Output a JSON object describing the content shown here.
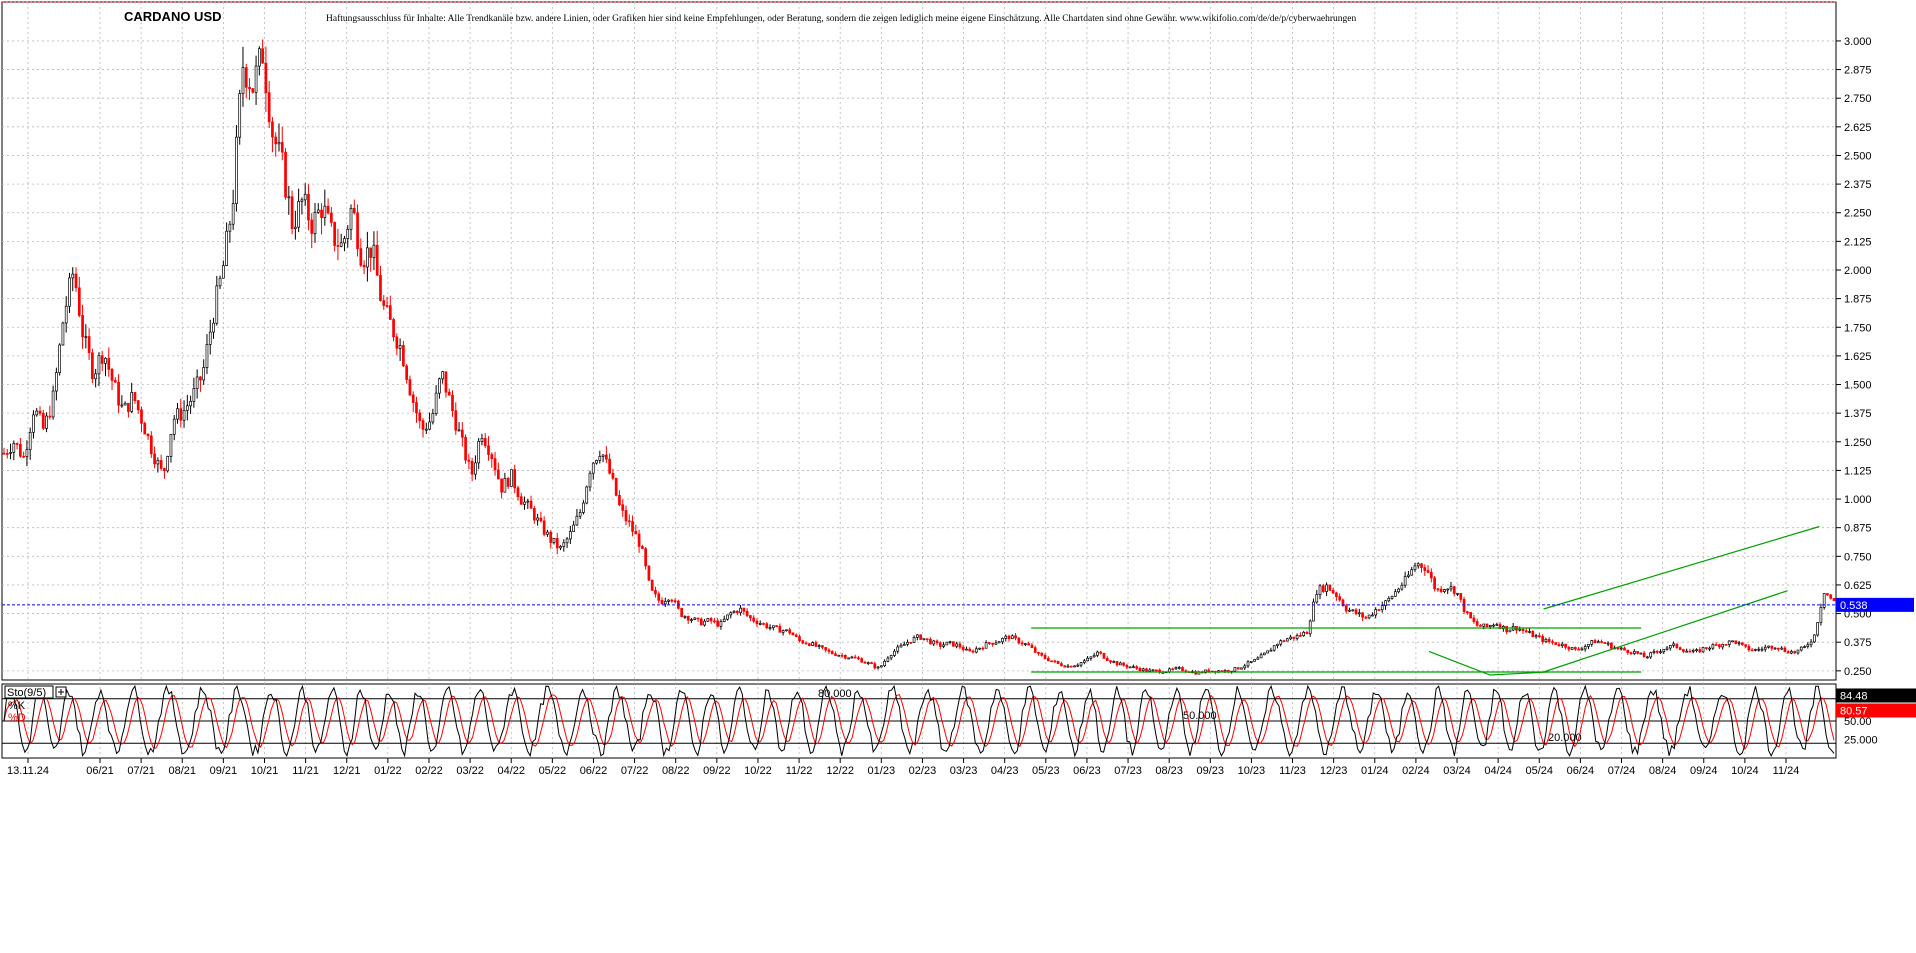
{
  "chart_data": {
    "type": "candlestick",
    "title": "CARDANO USD",
    "disclaimer": "Haftungsausschluss für Inhalte: Alle Trendkanäle bzw. andere Linien, oder Grafiken hier sind keine Empfehlungen, oder Beratung, sondern die zeigen lediglich meine eigene Einschätzung. Alle Chartdaten sind ohne Gewähr. www.wikifolio.com/de/de/p/cyberwaehrungen",
    "ylim": [
      0.21,
      3.17
    ],
    "y_ticks": [
      "3.000",
      "2.875",
      "2.750",
      "2.625",
      "2.500",
      "2.375",
      "2.250",
      "2.125",
      "2.000",
      "1.875",
      "1.750",
      "1.625",
      "1.500",
      "1.375",
      "1.250",
      "1.125",
      "1.000",
      "0.875",
      "0.750",
      "0.625",
      "0.500",
      "0.375",
      "0.250"
    ],
    "x_ticks": [
      "13.11.24",
      "06/21",
      "07/21",
      "08/21",
      "09/21",
      "10/21",
      "11/21",
      "12/21",
      "01/22",
      "02/22",
      "03/22",
      "04/22",
      "05/22",
      "06/22",
      "07/22",
      "08/22",
      "09/22",
      "10/22",
      "11/22",
      "12/22",
      "01/23",
      "02/23",
      "03/23",
      "04/23",
      "05/23",
      "06/23",
      "07/23",
      "08/23",
      "09/23",
      "10/23",
      "11/23",
      "12/23",
      "01/24",
      "02/24",
      "03/24",
      "04/24",
      "05/24",
      "06/24",
      "07/24",
      "08/24",
      "09/24",
      "10/24",
      "11/24"
    ],
    "current_price": "0.538",
    "current_price_value": 0.538,
    "grid": true,
    "price_path": [
      [
        0.0,
        1.2
      ],
      [
        0.02,
        1.25
      ],
      [
        0.04,
        1.18
      ],
      [
        0.06,
        1.4
      ],
      [
        0.08,
        1.3
      ],
      [
        0.1,
        1.45
      ],
      [
        0.12,
        1.8
      ],
      [
        0.14,
        2.0
      ],
      [
        0.16,
        1.7
      ],
      [
        0.18,
        1.55
      ],
      [
        0.2,
        1.65
      ],
      [
        0.22,
        1.5
      ],
      [
        0.24,
        1.38
      ],
      [
        0.26,
        1.45
      ],
      [
        0.28,
        1.33
      ],
      [
        0.3,
        1.2
      ],
      [
        0.32,
        1.1
      ],
      [
        0.34,
        1.35
      ],
      [
        0.36,
        1.38
      ],
      [
        0.38,
        1.45
      ],
      [
        0.4,
        1.55
      ],
      [
        0.42,
        1.8
      ],
      [
        0.44,
        2.0
      ],
      [
        0.46,
        2.3
      ],
      [
        0.48,
        2.9
      ],
      [
        0.5,
        2.8
      ],
      [
        0.52,
        2.95
      ],
      [
        0.54,
        2.6
      ],
      [
        0.56,
        2.45
      ],
      [
        0.58,
        2.2
      ],
      [
        0.6,
        2.3
      ],
      [
        0.62,
        2.2
      ],
      [
        0.64,
        2.28
      ],
      [
        0.66,
        2.15
      ],
      [
        0.68,
        2.1
      ],
      [
        0.7,
        2.28
      ],
      [
        0.72,
        2.05
      ],
      [
        0.74,
        2.1
      ],
      [
        0.76,
        1.85
      ],
      [
        0.78,
        1.75
      ],
      [
        0.8,
        1.65
      ],
      [
        0.82,
        1.45
      ],
      [
        0.84,
        1.3
      ],
      [
        0.86,
        1.35
      ],
      [
        0.88,
        1.55
      ],
      [
        0.9,
        1.4
      ],
      [
        0.92,
        1.25
      ],
      [
        0.94,
        1.1
      ],
      [
        0.96,
        1.3
      ],
      [
        0.98,
        1.2
      ],
      [
        1.0,
        1.05
      ],
      [
        1.02,
        1.1
      ],
      [
        1.04,
        1.0
      ],
      [
        1.06,
        0.95
      ],
      [
        1.08,
        0.88
      ],
      [
        1.1,
        0.82
      ],
      [
        1.12,
        0.78
      ],
      [
        1.14,
        0.85
      ],
      [
        1.16,
        0.95
      ],
      [
        1.18,
        1.15
      ],
      [
        1.2,
        1.22
      ],
      [
        1.22,
        1.1
      ],
      [
        1.24,
        0.95
      ],
      [
        1.26,
        0.88
      ],
      [
        1.28,
        0.8
      ],
      [
        1.3,
        0.6
      ],
      [
        1.32,
        0.55
      ],
      [
        1.34,
        0.58
      ],
      [
        1.36,
        0.5
      ],
      [
        1.38,
        0.48
      ],
      [
        1.4,
        0.46
      ],
      [
        1.42,
        0.47
      ],
      [
        1.44,
        0.45
      ],
      [
        1.46,
        0.5
      ],
      [
        1.48,
        0.52
      ],
      [
        1.5,
        0.48
      ],
      [
        1.52,
        0.46
      ],
      [
        1.54,
        0.44
      ],
      [
        1.56,
        0.43
      ],
      [
        1.58,
        0.42
      ],
      [
        1.6,
        0.38
      ],
      [
        1.62,
        0.37
      ],
      [
        1.64,
        0.35
      ],
      [
        1.66,
        0.33
      ],
      [
        1.68,
        0.32
      ],
      [
        1.7,
        0.31
      ],
      [
        1.72,
        0.3
      ],
      [
        1.74,
        0.28
      ],
      [
        1.76,
        0.26
      ],
      [
        1.78,
        0.32
      ],
      [
        1.8,
        0.35
      ],
      [
        1.82,
        0.38
      ],
      [
        1.84,
        0.4
      ],
      [
        1.86,
        0.38
      ],
      [
        1.88,
        0.36
      ],
      [
        1.9,
        0.37
      ],
      [
        1.92,
        0.36
      ],
      [
        1.94,
        0.33
      ],
      [
        1.96,
        0.35
      ],
      [
        1.98,
        0.37
      ],
      [
        2.0,
        0.38
      ],
      [
        2.02,
        0.4
      ],
      [
        2.04,
        0.38
      ],
      [
        2.06,
        0.36
      ],
      [
        2.08,
        0.32
      ],
      [
        2.1,
        0.3
      ],
      [
        2.12,
        0.28
      ],
      [
        2.14,
        0.27
      ],
      [
        2.16,
        0.28
      ],
      [
        2.18,
        0.3
      ],
      [
        2.2,
        0.33
      ],
      [
        2.22,
        0.3
      ],
      [
        2.24,
        0.28
      ],
      [
        2.26,
        0.27
      ],
      [
        2.28,
        0.26
      ],
      [
        2.3,
        0.25
      ],
      [
        2.32,
        0.25
      ],
      [
        2.34,
        0.25
      ],
      [
        2.36,
        0.26
      ],
      [
        2.38,
        0.25
      ],
      [
        2.4,
        0.24
      ],
      [
        2.42,
        0.25
      ],
      [
        2.44,
        0.25
      ],
      [
        2.46,
        0.25
      ],
      [
        2.48,
        0.26
      ],
      [
        2.5,
        0.28
      ],
      [
        2.52,
        0.3
      ],
      [
        2.54,
        0.33
      ],
      [
        2.56,
        0.37
      ],
      [
        2.58,
        0.39
      ],
      [
        2.6,
        0.4
      ],
      [
        2.62,
        0.42
      ],
      [
        2.64,
        0.6
      ],
      [
        2.66,
        0.62
      ],
      [
        2.68,
        0.58
      ],
      [
        2.7,
        0.52
      ],
      [
        2.72,
        0.5
      ],
      [
        2.74,
        0.48
      ],
      [
        2.76,
        0.52
      ],
      [
        2.78,
        0.55
      ],
      [
        2.8,
        0.6
      ],
      [
        2.82,
        0.65
      ],
      [
        2.84,
        0.72
      ],
      [
        2.86,
        0.7
      ],
      [
        2.88,
        0.6
      ],
      [
        2.9,
        0.62
      ],
      [
        2.92,
        0.6
      ],
      [
        2.94,
        0.5
      ],
      [
        2.96,
        0.45
      ],
      [
        2.98,
        0.44
      ],
      [
        3.0,
        0.46
      ],
      [
        3.02,
        0.43
      ],
      [
        3.04,
        0.44
      ],
      [
        3.06,
        0.42
      ],
      [
        3.08,
        0.4
      ],
      [
        3.1,
        0.38
      ],
      [
        3.12,
        0.37
      ],
      [
        3.14,
        0.36
      ],
      [
        3.16,
        0.34
      ],
      [
        3.18,
        0.36
      ],
      [
        3.2,
        0.38
      ],
      [
        3.22,
        0.37
      ],
      [
        3.24,
        0.35
      ],
      [
        3.26,
        0.34
      ],
      [
        3.28,
        0.33
      ],
      [
        3.3,
        0.31
      ],
      [
        3.32,
        0.33
      ],
      [
        3.34,
        0.35
      ],
      [
        3.36,
        0.36
      ],
      [
        3.38,
        0.34
      ],
      [
        3.4,
        0.33
      ],
      [
        3.42,
        0.35
      ],
      [
        3.44,
        0.36
      ],
      [
        3.46,
        0.37
      ],
      [
        3.48,
        0.38
      ],
      [
        3.5,
        0.35
      ],
      [
        3.52,
        0.34
      ],
      [
        3.54,
        0.35
      ],
      [
        3.56,
        0.36
      ],
      [
        3.58,
        0.34
      ],
      [
        3.6,
        0.33
      ],
      [
        3.62,
        0.35
      ],
      [
        3.64,
        0.4
      ],
      [
        3.66,
        0.6
      ],
      [
        3.68,
        0.55
      ]
    ],
    "trendlines": [
      {
        "points": [
          [
            0.842,
            0.437
          ],
          [
            1.342,
            0.437
          ]
        ]
      },
      {
        "points": [
          [
            0.842,
            0.245
          ],
          [
            1.342,
            0.245
          ]
        ]
      },
      {
        "points": [
          [
            1.168,
            0.335
          ],
          [
            1.218,
            0.232
          ],
          [
            1.265,
            0.245
          ]
        ]
      },
      {
        "points": [
          [
            1.262,
            0.245
          ],
          [
            1.462,
            0.6
          ]
        ]
      },
      {
        "points": [
          [
            1.262,
            0.52
          ],
          [
            1.488,
            0.88
          ]
        ]
      }
    ],
    "stochastic": {
      "label": "Sto(9/5)",
      "k_label": "%K",
      "d_label": "%D",
      "k_value": "84.48",
      "d_value": "80.57",
      "k_value_num": 84.48,
      "d_value_num": 80.57,
      "levels": [
        80,
        50,
        20
      ],
      "level_labels": [
        "80.000",
        "50.000",
        "20.000"
      ],
      "axis_labels": [
        "50.00",
        "25.000"
      ],
      "ylim": [
        0,
        100
      ]
    },
    "colors": {
      "up": "#000000",
      "down": "#ff0000",
      "trendline": "#00a000",
      "price_line": "#0000ff",
      "price_badge": "#0000ff",
      "grid": "#b8b8b8",
      "k_line": "#000000",
      "d_line": "#ff0000"
    }
  }
}
